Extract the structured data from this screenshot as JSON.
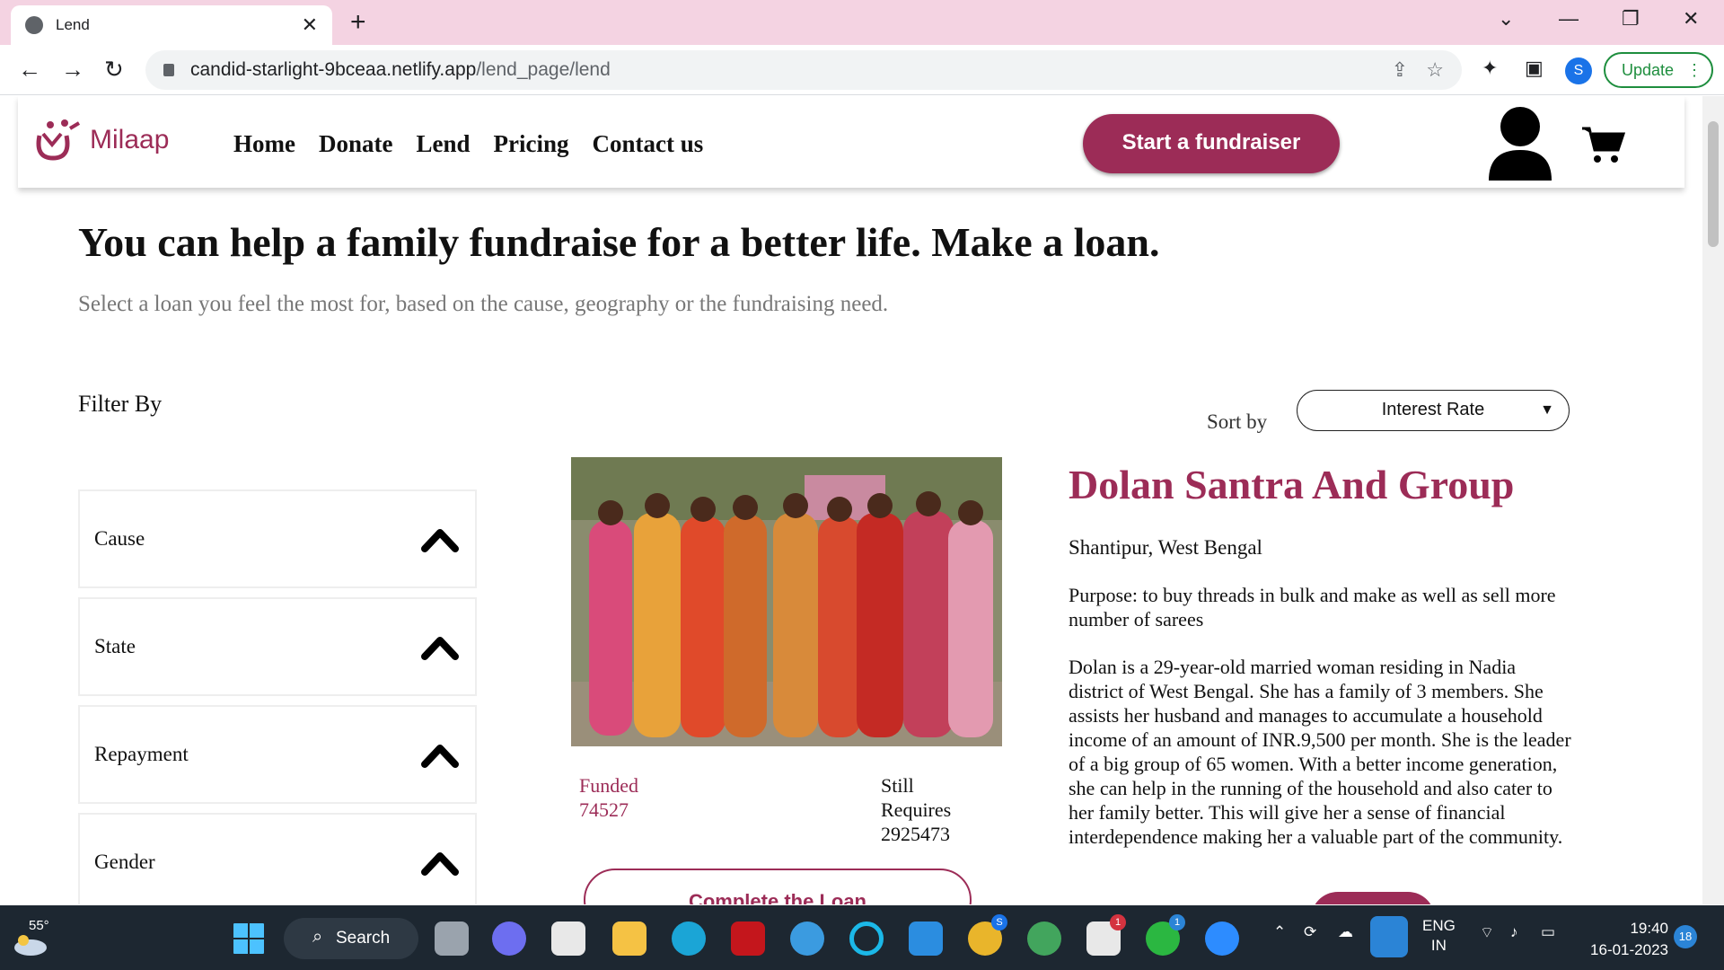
{
  "browser": {
    "tab_title": "Lend",
    "url_domain": "candid-starlight-9bceaa.netlify.app",
    "url_path": "/lend_page/lend",
    "profile_initial": "S",
    "update_label": "Update"
  },
  "site": {
    "logo_text": "Milaap",
    "nav": [
      "Home",
      "Donate",
      "Lend",
      "Pricing",
      "Contact us"
    ],
    "cta_label": "Start a fundraiser",
    "accent_color": "#9c2c57"
  },
  "main": {
    "heading": "You can help a family fundraise for a better life. Make a loan.",
    "subheading": "Select a loan you feel the most for, based on the cause, geography or the fundraising need.",
    "filter_title": "Filter By",
    "filters": [
      "Cause",
      "State",
      "Repayment",
      "Gender"
    ],
    "sort_label": "Sort by",
    "sort_value": "Interest Rate"
  },
  "loan": {
    "funded_label": "Funded",
    "funded_value": "74527",
    "still_label": "Still Requires",
    "still_value": "2925473",
    "complete_label": "Complete the Loan",
    "name": "Dolan Santra And Group",
    "location": "Shantipur, West Bengal",
    "purpose": "Purpose: to buy threads in bulk and make as well as sell more number of sarees",
    "description": "Dolan is a 29-year-old married woman residing in Nadia district of West Bengal. She has a family of 3 members. She assists her husband and manages to accumulate a household income of an amount of INR.9,500 per month. She is the leader of a big group of 65 women. With a better income generation, she can help in the running of the household and also cater to her family better. This will give her a sense of financial interdependence making her a valuable part of the community."
  },
  "taskbar": {
    "temperature": "55°",
    "search_label": "Search",
    "lang_top": "ENG",
    "lang_bottom": "IN",
    "time": "19:40",
    "date": "16-01-2023",
    "notification_count": "18",
    "badge_chrome": "S",
    "badge_slack": "1",
    "badge_whatsapp": "1"
  }
}
